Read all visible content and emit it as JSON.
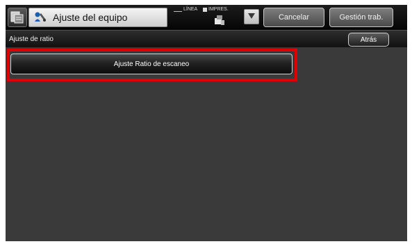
{
  "header": {
    "title": "Ajuste del equipo",
    "line_status": "LÍNEA",
    "print_status": "IMPRES.",
    "cancel_label": "Cancelar",
    "jobs_label": "Gestión trab."
  },
  "subheader": {
    "title": "Ajuste de ratio",
    "back_label": "Atrás"
  },
  "main": {
    "scan_ratio_label": "Ajuste Ratio de escaneo"
  },
  "icons": {
    "copy": "copy-icon",
    "settings": "settings-icon",
    "printer": "printer-icon",
    "dropdown": "dropdown-arrow-icon"
  },
  "colors": {
    "highlight": "#e00000",
    "screen_bg": "#3a3a3a"
  }
}
